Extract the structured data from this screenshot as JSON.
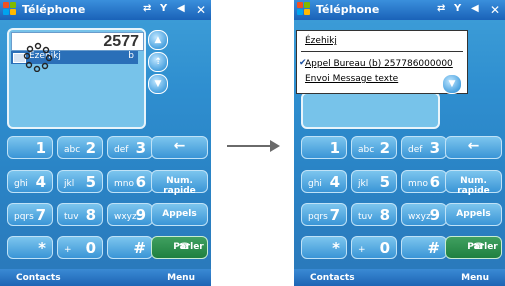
{
  "left": {
    "title": "Téléphone",
    "number": "2577",
    "entry": {
      "name": "Ézehikj",
      "type": "b"
    },
    "keys": [
      {
        "sub": "",
        "big": "1"
      },
      {
        "sub": "abc",
        "big": "2"
      },
      {
        "sub": "def",
        "big": "3"
      },
      {
        "sub": "ghi",
        "big": "4"
      },
      {
        "sub": "jkl",
        "big": "5"
      },
      {
        "sub": "mno",
        "big": "6"
      },
      {
        "sub": "pqrs",
        "big": "7"
      },
      {
        "sub": "tuv",
        "big": "8"
      },
      {
        "sub": "wxyz",
        "big": "9"
      },
      {
        "sub": "",
        "big": "*"
      },
      {
        "sub": "+",
        "big": "0"
      },
      {
        "sub": "",
        "big": "#"
      }
    ],
    "back_label": "←",
    "speed_dial": "Num. rapide",
    "calls": "Appels",
    "talk": "Parler",
    "softkey_left": "Contacts",
    "softkey_right": "Menu"
  },
  "right": {
    "title": "Téléphone",
    "menu": {
      "header": "Ézehikj",
      "item1": "Appel Bureau (b) 257786000000",
      "item2": "Envoi Message texte"
    },
    "softkey_left": "Contacts",
    "softkey_right": "Menu"
  },
  "colors": {
    "accent": "#2a8ad4",
    "talk_green": "#1f8040"
  }
}
